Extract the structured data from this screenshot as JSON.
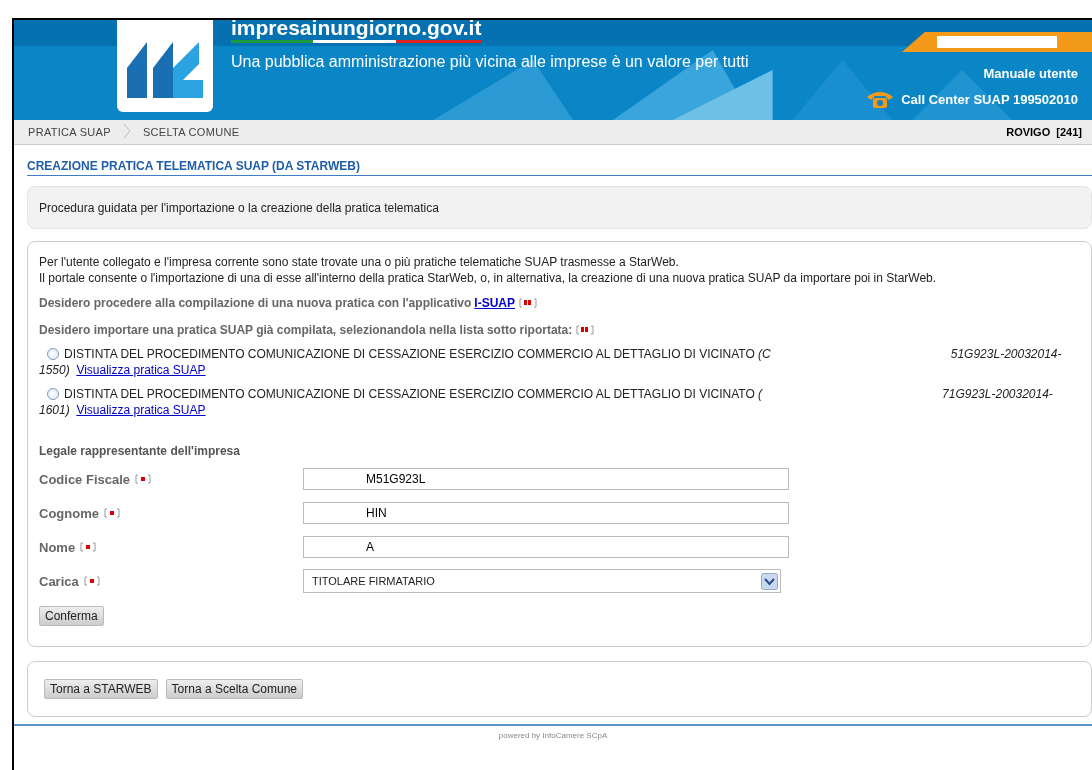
{
  "header": {
    "site": "impresainungiorno.gov.it",
    "tagline": "Una pubblica amministrazione più vicina alle imprese è un valore per tutti",
    "links": [
      {
        "label": "Manuale utente",
        "kind": "plain"
      },
      {
        "label": "Call Center SUAP 199502010",
        "kind": "phone"
      }
    ]
  },
  "breadcrumb": {
    "items": [
      "PRATICA SUAP",
      "SCELTA COMUNE"
    ],
    "location": "ROVIGO  [241]"
  },
  "page_title": "CREAZIONE PRATICA TELEMATICA SUAP (DA STARWEB)",
  "intro": "Procedura guidata per l'importazione o la creazione della pratica telematica",
  "info_lines": [
    "Per l'utente collegato e l'impresa corrente sono state trovate una o più pratiche telematiche SUAP trasmesse a StarWeb.",
    "Il portale consente o l'importazione di una di esse all'interno della pratica StarWeb, o, in alternativa, la creazione di una nuova pratica SUAP da importare poi in StarWeb."
  ],
  "option_new": {
    "label": "Desidero procedere alla compilazione di una nuova pratica con l'applicativo",
    "link": "I-SUAP"
  },
  "option_import": {
    "label": "Desidero importare una pratica SUAP già compilata, selezionandola nella lista sotto riportata:"
  },
  "pratiche": [
    {
      "selected": false,
      "title": "DISTINTA DEL PROCEDIMENTO COMUNICAZIONE DI CESSAZIONE ESERCIZIO COMMERCIO AL DETTAGLIO DI VICINATO",
      "code_start": "(C",
      "code_end": "51G923L-20032014-",
      "code_tail": "1550)",
      "link": "Visualizza pratica SUAP"
    },
    {
      "selected": false,
      "title": "DISTINTA DEL PROCEDIMENTO COMUNICAZIONE DI CESSAZIONE ESERCIZIO COMMERCIO AL DETTAGLIO DI VICINATO",
      "code_start": "(",
      "code_end": "71G923L-20032014-",
      "code_tail": "1601)",
      "link": "Visualizza pratica SUAP"
    }
  ],
  "form": {
    "heading": "Legale rappresentante dell'impresa",
    "fields": [
      {
        "label": "Codice Fiscale",
        "kind": "text",
        "value": "M51G923L"
      },
      {
        "label": "Cognome",
        "kind": "text",
        "value": "HIN"
      },
      {
        "label": "Nome",
        "kind": "text",
        "value": "A"
      },
      {
        "label": "Carica",
        "kind": "select",
        "value": "TITOLARE FIRMATARIO"
      }
    ],
    "submit": "Conferma"
  },
  "nav_buttons": [
    "Torna a STARWEB",
    "Torna a Scelta Comune"
  ],
  "footer": "powered by InfoCamere SCpA"
}
